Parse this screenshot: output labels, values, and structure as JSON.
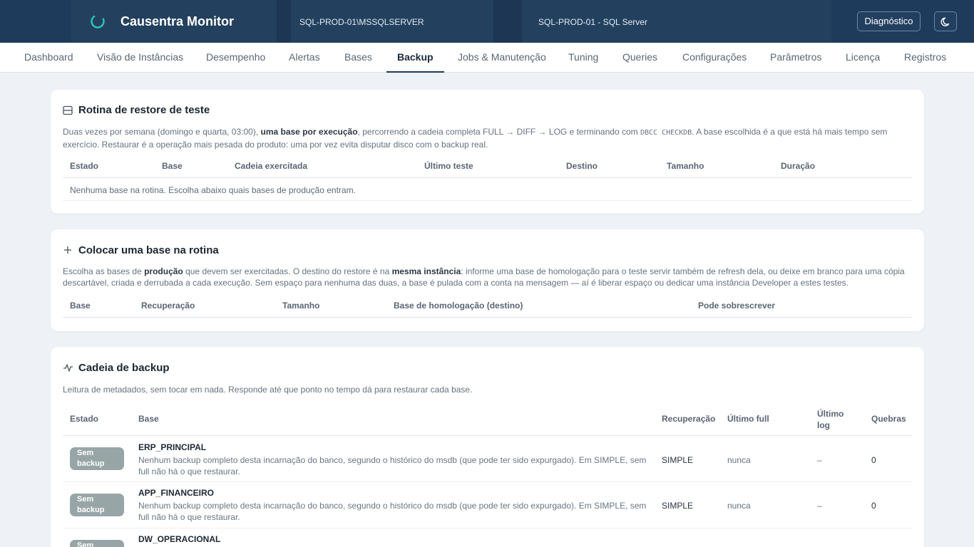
{
  "app": {
    "title": "Causentra Monitor",
    "instance": "SQL-PROD-01\\MSSQLSERVER",
    "server": "SQL-PROD-01 - SQL Server",
    "diagnostics_label": "Diagnóstico",
    "theme_icon": "moon-icon",
    "logo_icon": "circular-logo-icon"
  },
  "colors": {
    "header_bg": "#1f3b5c",
    "badge_bg": "#98a5a6",
    "page_bg": "#eef1f5"
  },
  "nav": {
    "tabs": [
      {
        "label": "Dashboard"
      },
      {
        "label": "Visão de Instâncias"
      },
      {
        "label": "Desempenho"
      },
      {
        "label": "Alertas"
      },
      {
        "label": "Bases"
      },
      {
        "label": "Backup",
        "active": true
      },
      {
        "label": "Jobs & Manutenção"
      },
      {
        "label": "Tuning"
      },
      {
        "label": "Queries"
      },
      {
        "label": "Configurações"
      },
      {
        "label": "Parâmetros"
      },
      {
        "label": "Licença"
      },
      {
        "label": "Registros"
      }
    ]
  },
  "restore_test": {
    "title": "Rotina de restore de teste",
    "desc_1": "Duas vezes por semana (domingo e quarta, 03:00), ",
    "desc_bold": "uma base por execução",
    "desc_2": ", percorrendo a cadeia completa FULL → DIFF → LOG e terminando com ",
    "desc_code": "DBCC CHECKDB",
    "desc_3": ". A base escolhida é a que está há mais tempo sem exercício. Restaurar é a operação mais pesada do produto: uma por vez evita disputar disco com o backup real.",
    "columns": [
      "Estado",
      "Base",
      "Cadeia exercitada",
      "Último teste",
      "Destino",
      "Tamanho",
      "Duração"
    ],
    "empty_message": "Nenhuma base na rotina. Escolha abaixo quais bases de produção entram."
  },
  "add_to_routine": {
    "title": "Colocar uma base na rotina",
    "desc_1": "Escolha as bases de ",
    "desc_bold_1": "produção",
    "desc_2": " que devem ser exercitadas. O destino do restore é na ",
    "desc_bold_2": "mesma instância",
    "desc_3": ": informe uma base de homologação para o teste servir também de refresh dela, ou deixe em branco para uma cópia descartável, criada e derrubada a cada execução. Sem espaço para nenhuma das duas, a base é pulada com a conta na mensagem — aí é liberar espaço ou dedicar uma instância Developer a estes testes.",
    "columns": [
      "Base",
      "Recuperação",
      "Tamanho",
      "Base de homologação (destino)",
      "Pode sobrescrever"
    ]
  },
  "backup_chain": {
    "title": "Cadeia de backup",
    "desc": "Leitura de metadados, sem tocar em nada. Responde até que ponto no tempo dá para restaurar cada base.",
    "columns": {
      "estado": "Estado",
      "base": "Base",
      "recuperacao": "Recuperação",
      "ultimo_full": "Último full",
      "ultimo_log": "Último log",
      "quebras": "Quebras"
    },
    "rows": [
      {
        "status": "Sem backup",
        "name": "ERP_PRINCIPAL",
        "description": "Nenhum backup completo desta incarnação do banco, segundo o histórico do msdb (que pode ter sido expurgado). Em SIMPLE, sem full não há o que restaurar.",
        "recovery": "SIMPLE",
        "last_full": "nunca",
        "last_log": "–",
        "breaks": "0"
      },
      {
        "status": "Sem backup",
        "name": "APP_FINANCEIRO",
        "description": "Nenhum backup completo desta incarnação do banco, segundo o histórico do msdb (que pode ter sido expurgado). Em SIMPLE, sem full não há o que restaurar.",
        "recovery": "SIMPLE",
        "last_full": "nunca",
        "last_log": "–",
        "breaks": "0"
      },
      {
        "status": "Sem backup",
        "name": "DW_OPERACIONAL"
      }
    ]
  }
}
